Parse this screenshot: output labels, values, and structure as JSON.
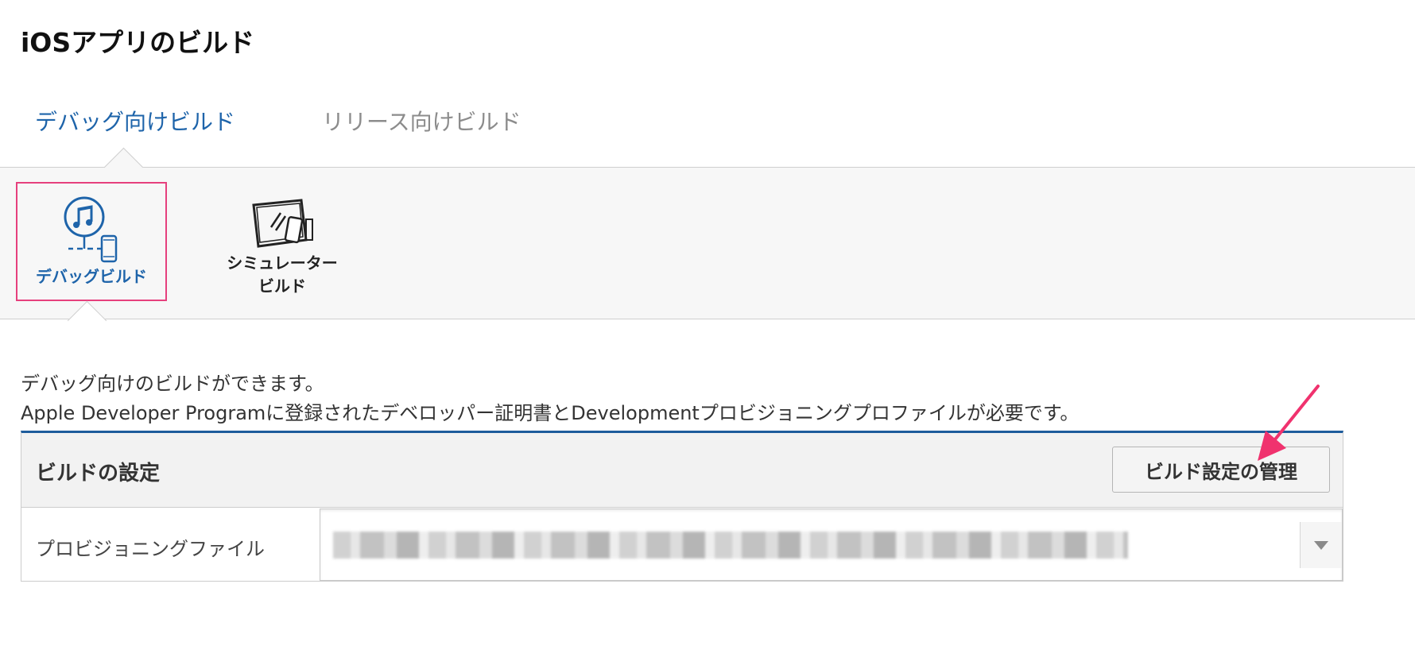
{
  "page": {
    "title": "iOSアプリのビルド"
  },
  "tabs": [
    {
      "label": "デバッグ向けビルド",
      "active": true
    },
    {
      "label": "リリース向けビルド",
      "active": false
    }
  ],
  "build_options": [
    {
      "label": "デバッグビルド",
      "selected": true,
      "icon": "itunes-device-icon"
    },
    {
      "label_line1": "シミュレーター",
      "label_line2": "ビルド",
      "selected": false,
      "icon": "simulator-icon"
    }
  ],
  "description": {
    "line1": "デバッグ向けのビルドができます。",
    "line2": "Apple Developer Programに登録されたデベロッパー証明書とDevelopmentプロビジョニングプロファイルが必要です。"
  },
  "settings": {
    "title": "ビルドの設定",
    "manage_button": "ビルド設定の管理",
    "provisioning_label": "プロビジョニングファイル"
  },
  "colors": {
    "accent": "#1e64aa",
    "selection_border": "#e6407d",
    "annotation_arrow": "#f0326e"
  }
}
